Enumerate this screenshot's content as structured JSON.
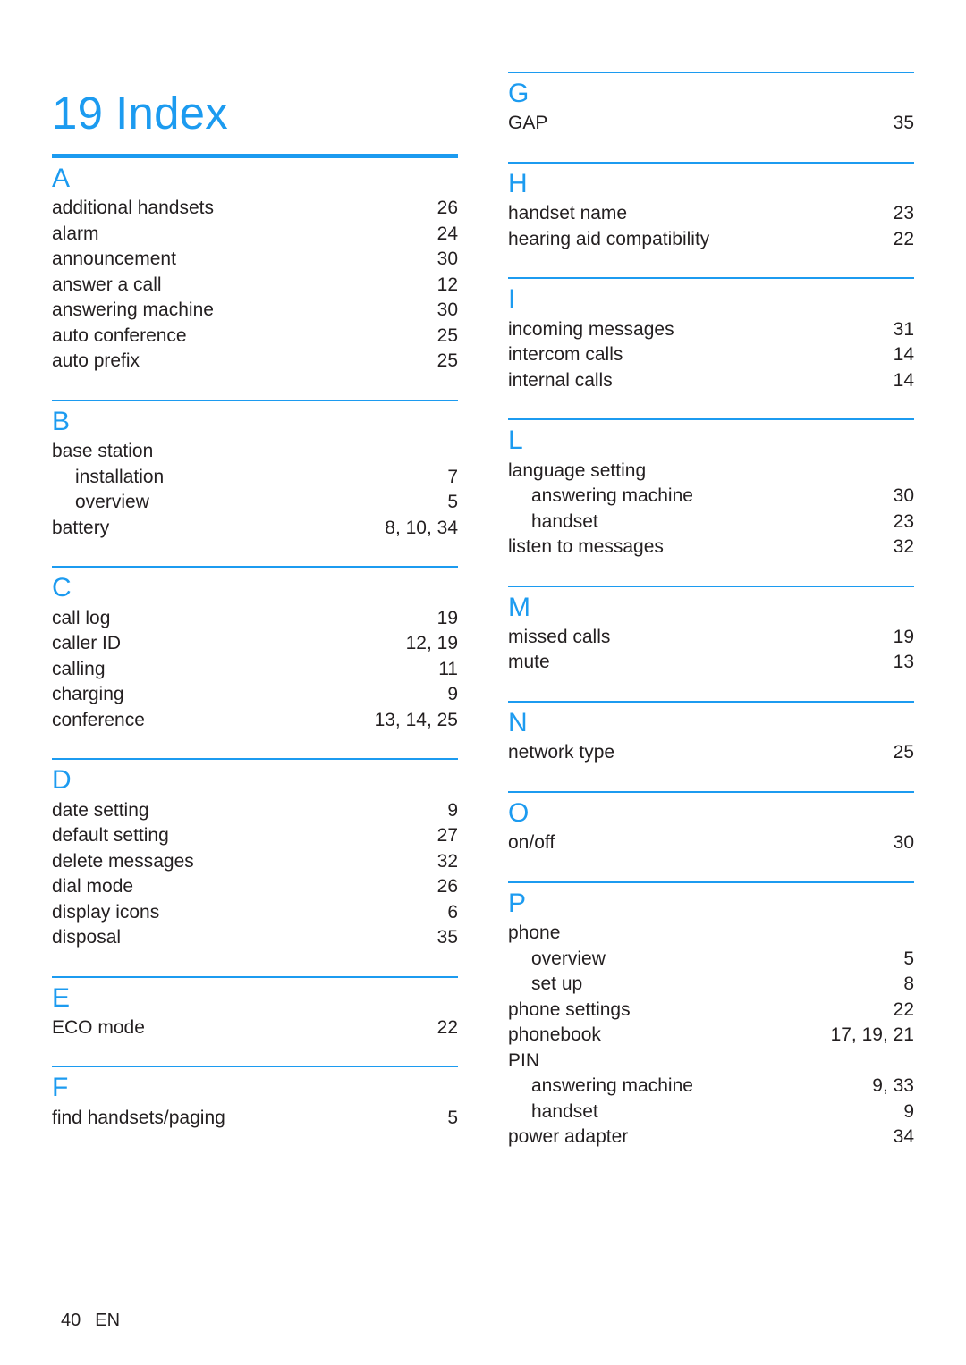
{
  "title": {
    "number": "19",
    "text": "Index"
  },
  "accent_color": "#1c9bf0",
  "text_color": "#231f20",
  "footer": {
    "page_number": "40",
    "language": "EN"
  },
  "columns": [
    {
      "name": "left-column",
      "sections": [
        {
          "letter": "A",
          "entries": [
            {
              "label": "additional handsets",
              "pages": "26",
              "level": 0
            },
            {
              "label": "alarm",
              "pages": "24",
              "level": 0
            },
            {
              "label": "announcement",
              "pages": "30",
              "level": 0
            },
            {
              "label": "answer a call",
              "pages": "12",
              "level": 0
            },
            {
              "label": "answering machine",
              "pages": "30",
              "level": 0
            },
            {
              "label": "auto conference",
              "pages": "25",
              "level": 0
            },
            {
              "label": "auto prefix",
              "pages": "25",
              "level": 0
            }
          ]
        },
        {
          "letter": "B",
          "entries": [
            {
              "label": "base station",
              "pages": "",
              "level": 0
            },
            {
              "label": "installation",
              "pages": "7",
              "level": 1
            },
            {
              "label": "overview",
              "pages": "5",
              "level": 1
            },
            {
              "label": "battery",
              "pages": "8, 10, 34",
              "level": 0
            }
          ]
        },
        {
          "letter": "C",
          "entries": [
            {
              "label": "call log",
              "pages": "19",
              "level": 0
            },
            {
              "label": "caller ID",
              "pages": "12, 19",
              "level": 0
            },
            {
              "label": "calling",
              "pages": "11",
              "level": 0
            },
            {
              "label": "charging",
              "pages": "9",
              "level": 0
            },
            {
              "label": "conference",
              "pages": "13, 14, 25",
              "level": 0
            }
          ]
        },
        {
          "letter": "D",
          "entries": [
            {
              "label": "date setting",
              "pages": "9",
              "level": 0
            },
            {
              "label": "default setting",
              "pages": "27",
              "level": 0
            },
            {
              "label": "delete messages",
              "pages": "32",
              "level": 0
            },
            {
              "label": "dial mode",
              "pages": "26",
              "level": 0
            },
            {
              "label": "display icons",
              "pages": "6",
              "level": 0
            },
            {
              "label": "disposal",
              "pages": "35",
              "level": 0
            }
          ]
        },
        {
          "letter": "E",
          "entries": [
            {
              "label": "ECO mode",
              "pages": "22",
              "level": 0
            }
          ]
        },
        {
          "letter": "F",
          "entries": [
            {
              "label": "find handsets/paging",
              "pages": "5",
              "level": 0
            }
          ]
        }
      ]
    },
    {
      "name": "right-column",
      "sections": [
        {
          "letter": "G",
          "entries": [
            {
              "label": "GAP",
              "pages": "35",
              "level": 0
            }
          ]
        },
        {
          "letter": "H",
          "entries": [
            {
              "label": "handset name",
              "pages": "23",
              "level": 0
            },
            {
              "label": "hearing aid compatibility",
              "pages": "22",
              "level": 0
            }
          ]
        },
        {
          "letter": "I",
          "entries": [
            {
              "label": "incoming messages",
              "pages": "31",
              "level": 0
            },
            {
              "label": "intercom calls",
              "pages": "14",
              "level": 0
            },
            {
              "label": "internal calls",
              "pages": "14",
              "level": 0
            }
          ]
        },
        {
          "letter": "L",
          "entries": [
            {
              "label": "language setting",
              "pages": "",
              "level": 0
            },
            {
              "label": "answering machine",
              "pages": "30",
              "level": 1
            },
            {
              "label": "handset",
              "pages": "23",
              "level": 1
            },
            {
              "label": "listen to messages",
              "pages": "32",
              "level": 0
            }
          ]
        },
        {
          "letter": "M",
          "entries": [
            {
              "label": "missed calls",
              "pages": "19",
              "level": 0
            },
            {
              "label": "mute",
              "pages": "13",
              "level": 0
            }
          ]
        },
        {
          "letter": "N",
          "entries": [
            {
              "label": "network type",
              "pages": "25",
              "level": 0
            }
          ]
        },
        {
          "letter": "O",
          "entries": [
            {
              "label": "on/off",
              "pages": "30",
              "level": 0
            }
          ]
        },
        {
          "letter": "P",
          "entries": [
            {
              "label": "phone",
              "pages": "",
              "level": 0
            },
            {
              "label": "overview",
              "pages": "5",
              "level": 1
            },
            {
              "label": "set up",
              "pages": "8",
              "level": 1
            },
            {
              "label": "phone settings",
              "pages": "22",
              "level": 0
            },
            {
              "label": "phonebook",
              "pages": "17, 19, 21",
              "level": 0
            },
            {
              "label": "PIN",
              "pages": "",
              "level": 0
            },
            {
              "label": "answering machine",
              "pages": "9, 33",
              "level": 1
            },
            {
              "label": "handset",
              "pages": "9",
              "level": 1
            },
            {
              "label": "power adapter",
              "pages": "34",
              "level": 0
            }
          ]
        }
      ]
    }
  ]
}
